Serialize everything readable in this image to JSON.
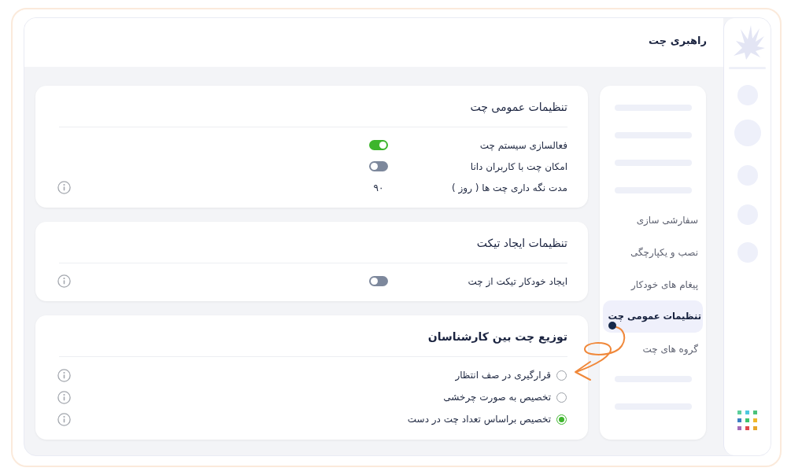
{
  "header": {
    "title": "راهبری چت"
  },
  "sidebar": {
    "items": [
      {
        "label": "سفارشی سازی",
        "selected": false
      },
      {
        "label": "نصب و یکپارچگی",
        "selected": false
      },
      {
        "label": "پیغام های خودکار",
        "selected": false
      },
      {
        "label": "تنظیمات عمومی چت",
        "selected": true
      },
      {
        "label": "گروه های چت",
        "selected": false
      }
    ]
  },
  "sections": [
    {
      "title": "تنظیمات عمومی چت",
      "emphasized": false,
      "rows": [
        {
          "kind": "toggle",
          "label": "فعالسازی سیستم چت",
          "on": true,
          "info": false
        },
        {
          "kind": "toggle",
          "label": "امکان چت با کاربران دانا",
          "on": false,
          "info": false
        },
        {
          "kind": "value",
          "label": "مدت نگه داری چت ها ( روز )",
          "value": "۹۰",
          "info": true
        }
      ]
    },
    {
      "title": "تنظیمات ایجاد تیکت",
      "emphasized": false,
      "rows": [
        {
          "kind": "toggle",
          "label": "ایجاد خودکار تیکت از چت",
          "on": false,
          "info": true
        }
      ]
    },
    {
      "title": "توزیع چت بین کارشناسان",
      "emphasized": true,
      "rows": [
        {
          "kind": "radio",
          "label": "قرارگیری در صف انتظار",
          "selected": false,
          "info": true
        },
        {
          "kind": "radio",
          "label": "تخصیص به صورت چرخشی",
          "selected": false,
          "info": true
        },
        {
          "kind": "radio",
          "label": "تخصیص براساس تعداد چت در دست",
          "selected": true,
          "info": true
        }
      ]
    }
  ]
}
